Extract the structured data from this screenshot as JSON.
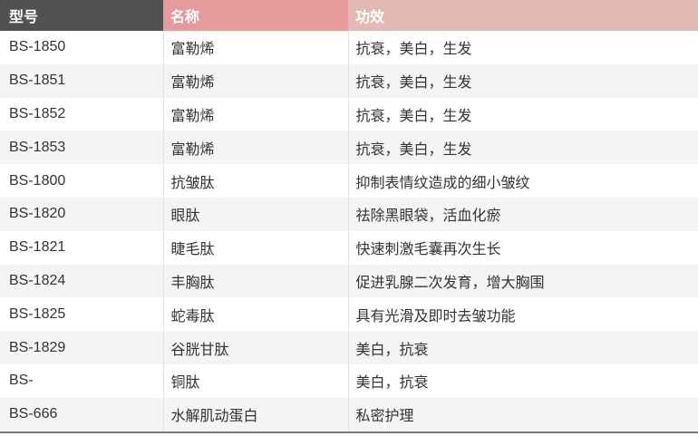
{
  "header": {
    "model": "型号",
    "name": "名称",
    "effect": "功效"
  },
  "rows": [
    {
      "model": "BS-1850",
      "name": "富勒烯",
      "effect": "抗衰，美白，生发"
    },
    {
      "model": "BS-1851",
      "name": "富勒烯",
      "effect": "抗衰，美白，生发"
    },
    {
      "model": "BS-1852",
      "name": "富勒烯",
      "effect": "抗衰，美白，生发"
    },
    {
      "model": "BS-1853",
      "name": "富勒烯",
      "effect": "抗衰，美白，生发"
    },
    {
      "model": "BS-1800",
      "name": "抗皱肽",
      "effect": "抑制表情纹造成的细小皱纹"
    },
    {
      "model": "BS-1820",
      "name": "眼肽",
      "effect": "祛除黑眼袋，活血化瘀"
    },
    {
      "model": "BS-1821",
      "name": "睫毛肽",
      "effect": "快速刺激毛囊再次生长"
    },
    {
      "model": "BS-1824",
      "name": "丰胸肽",
      "effect": "促进乳腺二次发育，增大胸围"
    },
    {
      "model": "BS-1825",
      "name": "蛇毒肽",
      "effect": "具有光滑及即时去皱功能"
    },
    {
      "model": "BS-1829",
      "name": "谷胱甘肽",
      "effect": "美白，抗衰"
    },
    {
      "model": "BS-",
      "name": "铜肽",
      "effect": "美白，抗衰"
    },
    {
      "model": "BS-666",
      "name": "水解肌动蛋白",
      "effect": "私密护理"
    }
  ]
}
